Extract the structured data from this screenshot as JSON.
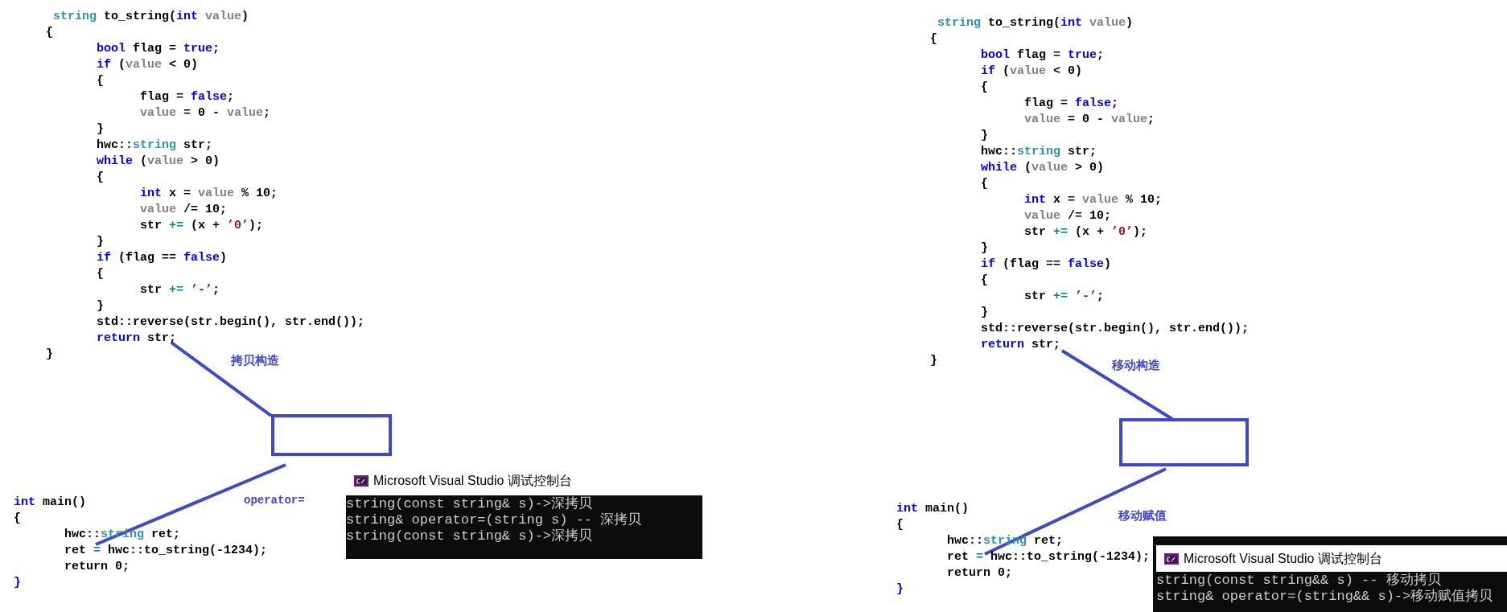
{
  "panels": [
    {
      "function_code": [
        [
          {
            "text": " string",
            "kind": "type"
          },
          {
            "text": " to_string(",
            "kind": "plain"
          },
          {
            "text": "int",
            "kind": "keyword"
          },
          {
            "text": " value",
            "kind": "param"
          },
          {
            "text": ")",
            "kind": "plain"
          }
        ],
        [
          {
            "text": "{",
            "kind": "plain"
          }
        ],
        [
          {
            "text": "       bool",
            "kind": "keyword"
          },
          {
            "text": " flag = ",
            "kind": "plain"
          },
          {
            "text": "true",
            "kind": "keyword"
          },
          {
            "text": ";",
            "kind": "plain"
          }
        ],
        [
          {
            "text": "       if",
            "kind": "keyword"
          },
          {
            "text": " (",
            "kind": "plain"
          },
          {
            "text": "value",
            "kind": "param"
          },
          {
            "text": " < 0)",
            "kind": "plain"
          }
        ],
        [
          {
            "text": "       {",
            "kind": "plain"
          }
        ],
        [
          {
            "text": "             flag = ",
            "kind": "plain"
          },
          {
            "text": "false",
            "kind": "keyword"
          },
          {
            "text": ";",
            "kind": "plain"
          }
        ],
        [
          {
            "text": "             value",
            "kind": "param"
          },
          {
            "text": " = 0 - ",
            "kind": "plain"
          },
          {
            "text": "value",
            "kind": "param"
          },
          {
            "text": ";",
            "kind": "plain"
          }
        ],
        [
          {
            "text": "       }",
            "kind": "plain"
          }
        ],
        [
          {
            "text": "       hwc::",
            "kind": "plain"
          },
          {
            "text": "string",
            "kind": "type"
          },
          {
            "text": " str;",
            "kind": "plain"
          }
        ],
        [
          {
            "text": "       while",
            "kind": "keyword"
          },
          {
            "text": " (",
            "kind": "plain"
          },
          {
            "text": "value",
            "kind": "param"
          },
          {
            "text": " > 0)",
            "kind": "plain"
          }
        ],
        [
          {
            "text": "       {",
            "kind": "plain"
          }
        ],
        [
          {
            "text": "             int",
            "kind": "keyword"
          },
          {
            "text": " x = ",
            "kind": "plain"
          },
          {
            "text": "value",
            "kind": "param"
          },
          {
            "text": " % 10;",
            "kind": "plain"
          }
        ],
        [
          {
            "text": "             value",
            "kind": "param"
          },
          {
            "text": " /= 10;",
            "kind": "plain"
          }
        ],
        [
          {
            "text": "             str ",
            "kind": "plain"
          },
          {
            "text": "+=",
            "kind": "op"
          },
          {
            "text": " (x + ",
            "kind": "plain"
          },
          {
            "text": "’0’",
            "kind": "char"
          },
          {
            "text": ");",
            "kind": "plain"
          }
        ],
        [
          {
            "text": "       }",
            "kind": "plain"
          }
        ],
        [
          {
            "text": "       if",
            "kind": "keyword"
          },
          {
            "text": " (flag == ",
            "kind": "plain"
          },
          {
            "text": "false",
            "kind": "keyword"
          },
          {
            "text": ")",
            "kind": "plain"
          }
        ],
        [
          {
            "text": "       {",
            "kind": "plain"
          }
        ],
        [
          {
            "text": "             str ",
            "kind": "plain"
          },
          {
            "text": "+=",
            "kind": "op"
          },
          {
            "text": " ’-’",
            "kind": "char"
          },
          {
            "text": ";",
            "kind": "plain"
          }
        ],
        [
          {
            "text": "       }",
            "kind": "plain"
          }
        ],
        [
          {
            "text": "       std::reverse(str.begin(), str.end());",
            "kind": "plain"
          }
        ],
        [
          {
            "text": "       return",
            "kind": "keyword"
          },
          {
            "text": " str;",
            "kind": "plain"
          }
        ],
        [
          {
            "text": "}",
            "kind": "plain"
          }
        ]
      ],
      "annotation_1": "拷贝构造",
      "annotation_2": "operator=",
      "main_code": [
        [
          {
            "text": "int",
            "kind": "keyword"
          },
          {
            "text": " main()",
            "kind": "plain"
          }
        ],
        [
          {
            "text": "{",
            "kind": "plain"
          }
        ],
        [
          {
            "text": "       hwc::",
            "kind": "plain"
          },
          {
            "text": "string",
            "kind": "type"
          },
          {
            "text": " ret;",
            "kind": "plain"
          }
        ],
        [
          {
            "text": "       ret ",
            "kind": "plain"
          },
          {
            "text": "=",
            "kind": "op"
          },
          {
            "text": " hwc::to_string(-1234);",
            "kind": "plain"
          }
        ],
        [
          {
            "text": "       return 0;",
            "kind": "plain"
          }
        ],
        [
          {
            "text": "}",
            "kind": "keyword"
          }
        ]
      ],
      "console": {
        "title": "Microsoft Visual Studio 调试控制台",
        "lines": [
          "string(const string& s)->深拷贝",
          "string& operator=(string s) -- 深拷贝",
          "string(const string& s)->深拷贝"
        ]
      }
    },
    {
      "function_code": [
        [
          {
            "text": " string",
            "kind": "type"
          },
          {
            "text": " to_string(",
            "kind": "plain"
          },
          {
            "text": "int",
            "kind": "keyword"
          },
          {
            "text": " value",
            "kind": "param"
          },
          {
            "text": ")",
            "kind": "plain"
          }
        ],
        [
          {
            "text": "{",
            "kind": "plain"
          }
        ],
        [
          {
            "text": "       bool",
            "kind": "keyword"
          },
          {
            "text": " flag = ",
            "kind": "plain"
          },
          {
            "text": "true",
            "kind": "keyword"
          },
          {
            "text": ";",
            "kind": "plain"
          }
        ],
        [
          {
            "text": "       if",
            "kind": "keyword"
          },
          {
            "text": " (",
            "kind": "plain"
          },
          {
            "text": "value",
            "kind": "param"
          },
          {
            "text": " < 0)",
            "kind": "plain"
          }
        ],
        [
          {
            "text": "       {",
            "kind": "plain"
          }
        ],
        [
          {
            "text": "             flag = ",
            "kind": "plain"
          },
          {
            "text": "false",
            "kind": "keyword"
          },
          {
            "text": ";",
            "kind": "plain"
          }
        ],
        [
          {
            "text": "             value",
            "kind": "param"
          },
          {
            "text": " = 0 - ",
            "kind": "plain"
          },
          {
            "text": "value",
            "kind": "param"
          },
          {
            "text": ";",
            "kind": "plain"
          }
        ],
        [
          {
            "text": "       }",
            "kind": "plain"
          }
        ],
        [
          {
            "text": "       hwc::",
            "kind": "plain"
          },
          {
            "text": "string",
            "kind": "type"
          },
          {
            "text": " str;",
            "kind": "plain"
          }
        ],
        [
          {
            "text": "       while",
            "kind": "keyword"
          },
          {
            "text": " (",
            "kind": "plain"
          },
          {
            "text": "value",
            "kind": "param"
          },
          {
            "text": " > 0)",
            "kind": "plain"
          }
        ],
        [
          {
            "text": "       {",
            "kind": "plain"
          }
        ],
        [
          {
            "text": "             int",
            "kind": "keyword"
          },
          {
            "text": " x = ",
            "kind": "plain"
          },
          {
            "text": "value",
            "kind": "param"
          },
          {
            "text": " % 10;",
            "kind": "plain"
          }
        ],
        [
          {
            "text": "             value",
            "kind": "param"
          },
          {
            "text": " /= 10;",
            "kind": "plain"
          }
        ],
        [
          {
            "text": "             str ",
            "kind": "plain"
          },
          {
            "text": "+=",
            "kind": "op"
          },
          {
            "text": " (x + ",
            "kind": "plain"
          },
          {
            "text": "’0’",
            "kind": "char"
          },
          {
            "text": ");",
            "kind": "plain"
          }
        ],
        [
          {
            "text": "       }",
            "kind": "plain"
          }
        ],
        [
          {
            "text": "       if",
            "kind": "keyword"
          },
          {
            "text": " (flag == ",
            "kind": "plain"
          },
          {
            "text": "false",
            "kind": "keyword"
          },
          {
            "text": ")",
            "kind": "plain"
          }
        ],
        [
          {
            "text": "       {",
            "kind": "plain"
          }
        ],
        [
          {
            "text": "             str ",
            "kind": "plain"
          },
          {
            "text": "+=",
            "kind": "op"
          },
          {
            "text": " ’-’",
            "kind": "char"
          },
          {
            "text": ";",
            "kind": "plain"
          }
        ],
        [
          {
            "text": "       }",
            "kind": "plain"
          }
        ],
        [
          {
            "text": "       std::reverse(str.begin(), str.end());",
            "kind": "plain"
          }
        ],
        [
          {
            "text": "       return",
            "kind": "keyword"
          },
          {
            "text": " str;",
            "kind": "plain"
          }
        ],
        [
          {
            "text": "}",
            "kind": "plain"
          }
        ]
      ],
      "annotation_1": "移动构造",
      "annotation_2": "移动赋值",
      "main_code": [
        [
          {
            "text": "int",
            "kind": "keyword"
          },
          {
            "text": " main()",
            "kind": "plain"
          }
        ],
        [
          {
            "text": "{",
            "kind": "plain"
          }
        ],
        [
          {
            "text": "       hwc::",
            "kind": "plain"
          },
          {
            "text": "string",
            "kind": "type"
          },
          {
            "text": " ret;",
            "kind": "plain"
          }
        ],
        [
          {
            "text": "       ret ",
            "kind": "plain"
          },
          {
            "text": "=",
            "kind": "op"
          },
          {
            "text": " hwc::to_string(-1234);",
            "kind": "plain"
          }
        ],
        [
          {
            "text": "       return 0;",
            "kind": "plain"
          }
        ],
        [
          {
            "text": "}",
            "kind": "keyword"
          }
        ]
      ],
      "console": {
        "title": "Microsoft Visual Studio 调试控制台",
        "lines": [
          "string(const string&& s) -- 移动拷贝",
          "string& operator=(string&& s)->移动赋值拷贝"
        ]
      }
    }
  ]
}
